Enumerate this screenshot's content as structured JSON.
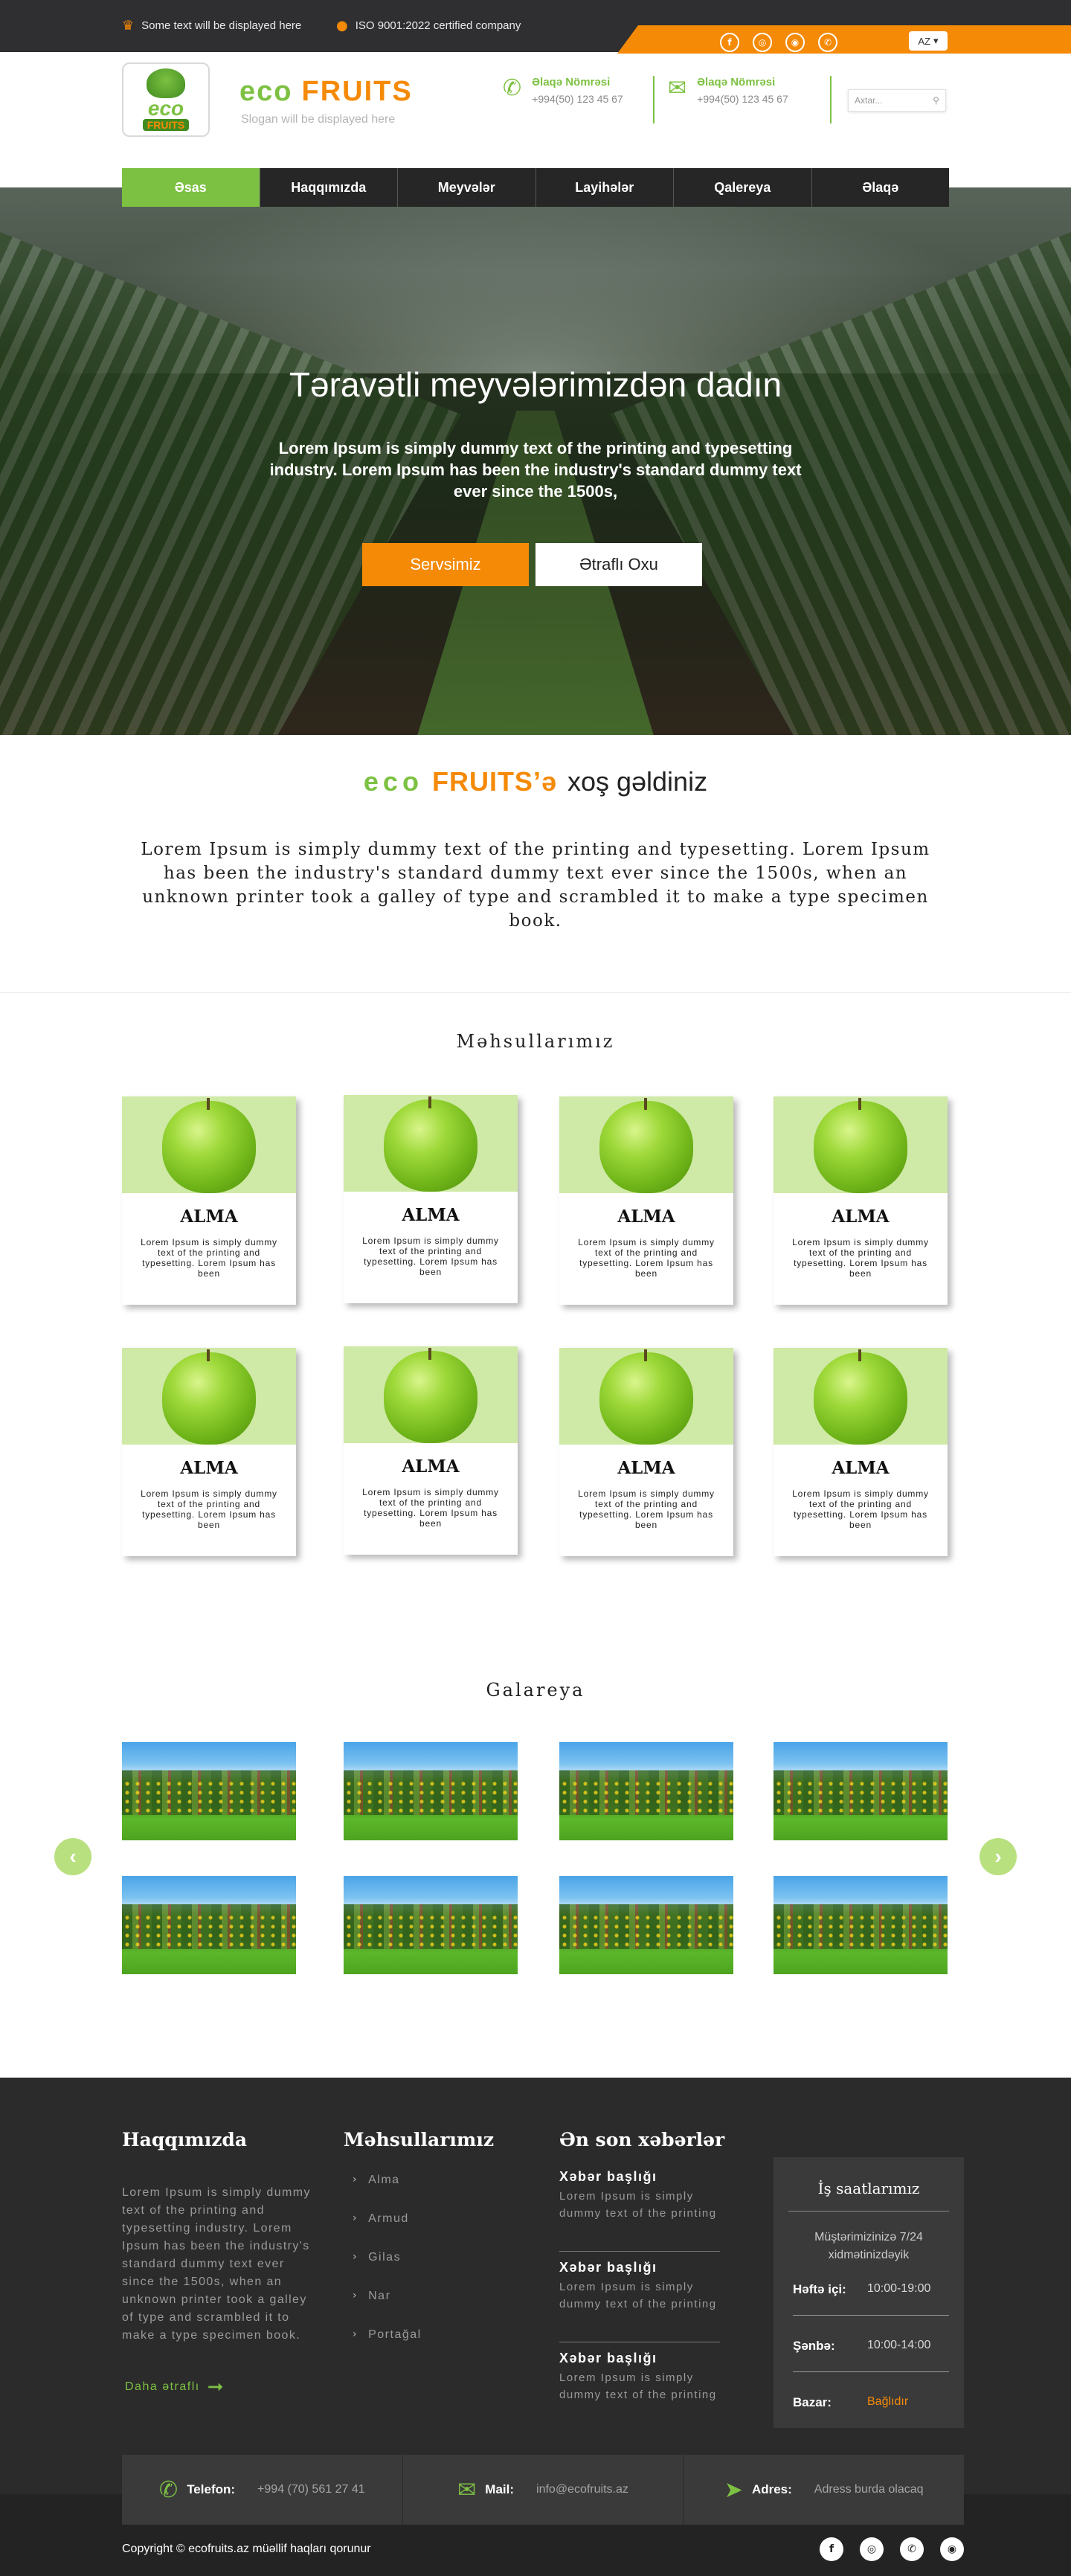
{
  "topbar": {
    "info1": "Some text will be displayed here",
    "info1_icon": "trophy-icon",
    "info2": "ISO 9001:2022 certified company",
    "info2_icon": "location-pin-icon",
    "socials": [
      "f",
      "◎",
      "◉",
      "✆"
    ],
    "social_names": [
      "facebook-icon",
      "instagram-icon",
      "messenger-icon",
      "whatsapp-icon"
    ],
    "language": "AZ"
  },
  "header": {
    "logo_top": "eco",
    "logo_bottom": "FRUITS",
    "brand_green": "eco",
    "brand_orange": "FRUITS",
    "slogan": "Slogan will be displayed here",
    "contact1_title": "Əlaqə Nömrəsi",
    "contact1_value": "+994(50) 123 45 67",
    "contact2_title": "Əlaqə Nömrəsi",
    "contact2_value": "+994(50) 123 45 67",
    "search_placeholder": "Axtar..."
  },
  "nav": {
    "items": [
      "Əsas",
      "Haqqımızda",
      "Meyvələr",
      "Layihələr",
      "Qalereya",
      "Əlaqə"
    ],
    "active": "Əsas"
  },
  "hero": {
    "title": "Təravətli meyvələrimizdən dadın",
    "text": "Lorem Ipsum is simply dummy text of the printing and typesetting industry. Lorem Ipsum has been the industry's standard dummy text ever since the 1500s,",
    "btn_primary": "Servsimiz",
    "btn_secondary": "Ətraflı Oxu"
  },
  "welcome": {
    "green": "eco",
    "orange": "FRUITS’ə",
    "black": "xoş gəldiniz",
    "text": "Lorem Ipsum is simply dummy text of the printing and typesetting. Lorem Ipsum has been the industry's standard dummy text ever since the 1500s, when an unknown printer took a galley of type and scrambled it to make a type specimen book."
  },
  "products": {
    "title": "Məhsullarımız",
    "items": [
      {
        "name": "ALMA",
        "desc": "Lorem Ipsum is simply dummy text of the printing and typesetting.  Lorem Ipsum has been"
      },
      {
        "name": "ALMA",
        "desc": "Lorem Ipsum is simply dummy text of the printing and typesetting.  Lorem Ipsum has been"
      },
      {
        "name": "ALMA",
        "desc": "Lorem Ipsum is simply dummy text of the printing and typesetting.  Lorem Ipsum has been"
      },
      {
        "name": "ALMA",
        "desc": "Lorem Ipsum is simply dummy text of the printing and typesetting.  Lorem Ipsum has been"
      },
      {
        "name": "ALMA",
        "desc": "Lorem Ipsum is simply dummy text of the printing and typesetting.  Lorem Ipsum has been"
      },
      {
        "name": "ALMA",
        "desc": "Lorem Ipsum is simply dummy text of the printing and typesetting.  Lorem Ipsum has been"
      },
      {
        "name": "ALMA",
        "desc": "Lorem Ipsum is simply dummy text of the printing and typesetting.  Lorem Ipsum has been"
      },
      {
        "name": "ALMA",
        "desc": "Lorem Ipsum is simply dummy text of the printing and typesetting.  Lorem Ipsum has been"
      }
    ]
  },
  "gallery": {
    "title": "Galareya",
    "prev_icon": "‹",
    "next_icon": "›"
  },
  "footer": {
    "about_title": "Haqqımızda",
    "about_text": "Lorem Ipsum is simply dummy text of the printing and typesetting industry. Lorem Ipsum has been the industry's standard dummy text ever since the 1500s, when an unknown printer took a galley of type and scrambled it to make a type specimen book.",
    "more": "Daha ətraflı",
    "products_title": "Məhsullarımız",
    "products": [
      "Alma",
      "Armud",
      "Gilas",
      "Nar",
      "Portağal"
    ],
    "news_title": "Ən son xəbərlər",
    "news": [
      {
        "title": "Xəbər başlığı",
        "text": "Lorem Ipsum is simply dummy text of the printing"
      },
      {
        "title": "Xəbər başlığı",
        "text": "Lorem Ipsum is simply dummy text of the printing"
      },
      {
        "title": "Xəbər başlığı",
        "text": "Lorem Ipsum is simply dummy text of the printing"
      }
    ],
    "hours": {
      "title": "İş saatlarımız",
      "note": "Müştərimizinizə 7/24 xidmətinizdəyik",
      "rows": [
        {
          "day": "Həftə içi:",
          "value": "10:00-19:00"
        },
        {
          "day": "Şənbə:",
          "value": "10:00-14:00"
        },
        {
          "day": "Bazar:",
          "value": "Bağlıdır"
        }
      ]
    },
    "contact": {
      "phone_label": "Telefon:",
      "phone_value": "+994 (70) 561 27 41",
      "mail_label": "Mail:",
      "mail_value": "info@ecofruits.az",
      "address_label": "Adres:",
      "address_value": "Adress burda olacaq"
    },
    "copyright": "Copyright © ecofruits.az müəllif haqları qorunur"
  },
  "colors": {
    "accent_green": "#7dc142",
    "accent_orange": "#f58a07",
    "dark": "#2b2b2c"
  }
}
